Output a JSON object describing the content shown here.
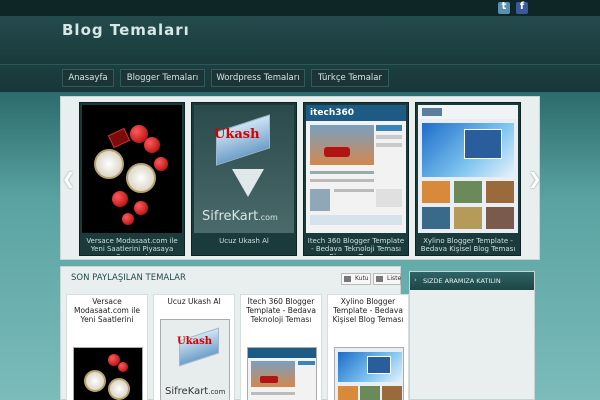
{
  "header": {
    "site_title": "Blog Temaları",
    "social": [
      "twitter-icon",
      "facebook-icon"
    ]
  },
  "nav": {
    "items": [
      "Anasayfa",
      "Blogger Temaları",
      "Wordpress Temaları",
      "Türkçe Temalar"
    ]
  },
  "slider": {
    "slides": [
      {
        "caption": "Versace Modasaat.com ile Yeni Saatlerini Piyasaya Sunuyor!"
      },
      {
        "caption": "Ucuz Ukash Al"
      },
      {
        "caption": "İtech 360 Blogger Template - Bedava Teknoloji Teması Blogger Teması"
      },
      {
        "caption": "Xylino Blogger Template - Bedava Kişisel Blog Teması"
      }
    ],
    "ukash_text": {
      "logo": "Ukash",
      "word": "SifreKart",
      "suffix": ".com"
    },
    "itech_logo": "itech360",
    "prev_icon": "chevron-left-icon",
    "next_icon": "chevron-right-icon"
  },
  "posts": {
    "title": "SON PAYLAŞILAN TEMALAR",
    "view_grid": "Kutu",
    "view_list": "Liste",
    "cards": [
      {
        "title": "Versace Modasaat.com ile Yeni Saatlerini Piyasaya Sunuyor!"
      },
      {
        "title": "Ucuz Ukash Al"
      },
      {
        "title": "İtech 360 Blogger Template - Bedava Teknoloji Teması Blogger Teması"
      },
      {
        "title": "Xylino Blogger Template - Bedava Kişisel Blog Teması"
      }
    ]
  },
  "sidebar": {
    "widget_title": "SIZDE ARAMIZA KATILIN"
  },
  "colors": {
    "accent": "#2e6465",
    "background": "#5aa3a2",
    "header": "#1a3a3b"
  }
}
